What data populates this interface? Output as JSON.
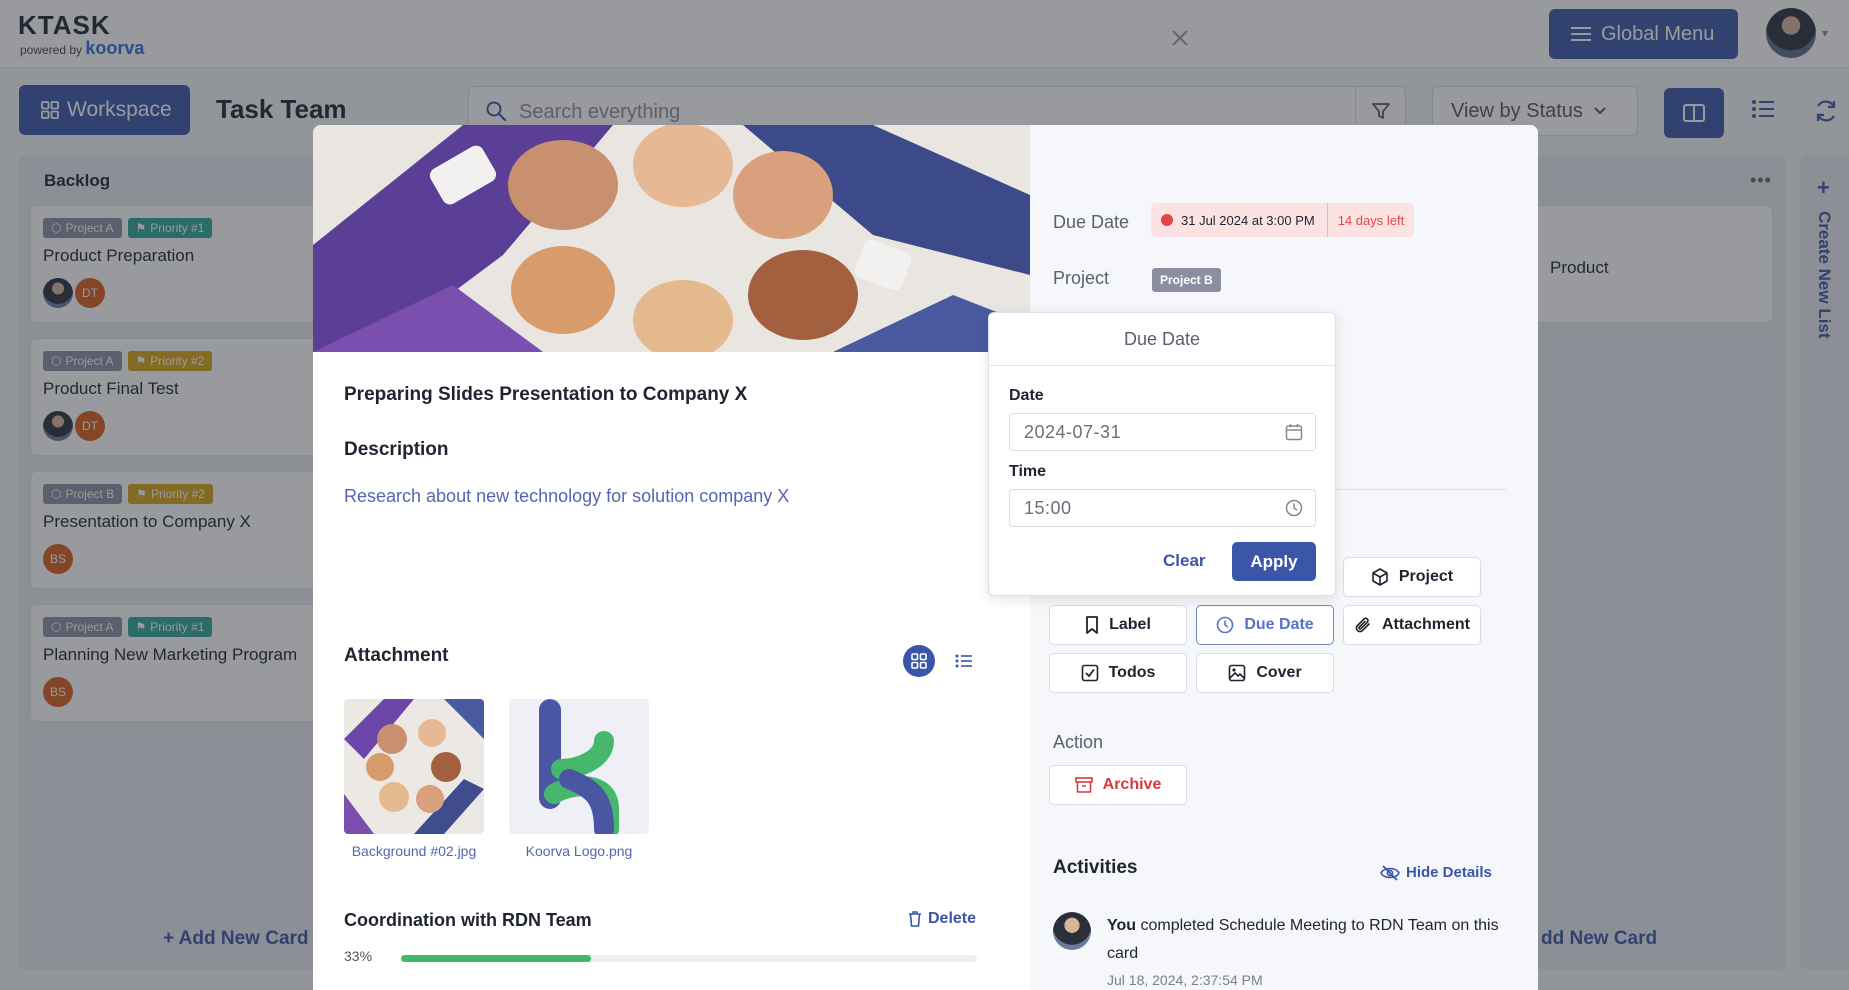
{
  "app": {
    "logo": "KTASK",
    "powered_by": "powered by",
    "brand": "koorva",
    "global_menu_label": "Global Menu"
  },
  "toolbar": {
    "workspace_label": "Workspace",
    "page_title": "Task Team",
    "search_placeholder": "Search everything",
    "view_by_label": "View by Status"
  },
  "board": {
    "backlog": {
      "title": "Backlog",
      "add_card_label": "Add New Card",
      "cards": [
        {
          "tags": [
            "Project A",
            "Priority #1"
          ],
          "title": "Product Preparation",
          "avatars": [
            "",
            "DT"
          ]
        },
        {
          "tags": [
            "Project A",
            "Priority #2"
          ],
          "title": "Product Final Test",
          "avatars": [
            "",
            "DT"
          ]
        },
        {
          "tags": [
            "Project B",
            "Priority #2"
          ],
          "title": "Presentation to Company X",
          "avatars": [
            "BS"
          ]
        },
        {
          "tags": [
            "Project A",
            "Priority #1"
          ],
          "title": "Planning New Marketing Program",
          "avatars": [
            "BS"
          ]
        }
      ]
    },
    "right_column": {
      "partial_card_text": "Product",
      "add_card_label": "dd New Card"
    },
    "create_list_label": "Create New List"
  },
  "modal": {
    "task_title": "Preparing Slides Presentation to Company X",
    "description_label": "Description",
    "description_text": "Research about new technology for solution company X",
    "attachment_label": "Attachment",
    "attachments": [
      {
        "name": "Background #02.jpg"
      },
      {
        "name": "Koorva Logo.png"
      }
    ],
    "checklist": {
      "title": "Coordination with RDN Team",
      "delete_label": "Delete",
      "progress_text": "33%",
      "progress_value": 0.33
    },
    "due_date_label": "Due Date",
    "due_date_value": "31 Jul 2024 at 3:00 PM",
    "due_date_remaining": "14 days left",
    "project_label": "Project",
    "project_value": "Project B",
    "actions": {
      "project": "Project",
      "label": "Label",
      "due_date": "Due Date",
      "attachment": "Attachment",
      "todos": "Todos",
      "cover": "Cover"
    },
    "action_section_label": "Action",
    "archive_label": "Archive",
    "activities_title": "Activities",
    "hide_details_label": "Hide Details",
    "activity": {
      "actor": "You",
      "text": " completed Schedule Meeting to RDN Team on this card",
      "time": "Jul 18, 2024, 2:37:54 PM"
    }
  },
  "popover": {
    "title": "Due Date",
    "date_label": "Date",
    "date_value": "2024-07-31",
    "time_label": "Time",
    "time_value": "15:00",
    "clear_label": "Clear",
    "apply_label": "Apply"
  },
  "colors": {
    "primary": "#3b56a8",
    "danger": "#e04848",
    "progress": "#3fb96a",
    "tag_gray": "#8d8ea1",
    "tag_teal": "#2fa89a",
    "tag_gold": "#d9a514"
  }
}
